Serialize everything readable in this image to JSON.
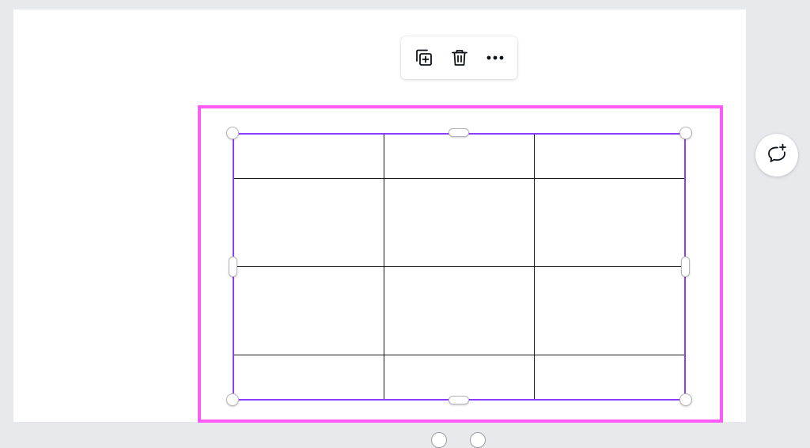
{
  "canvas": {
    "background": "#ffffff",
    "workspace_background": "#e8e9ed"
  },
  "toolbar": {
    "items": [
      {
        "icon": "duplicate-icon"
      },
      {
        "icon": "trash-icon"
      },
      {
        "icon": "more-horizontal-icon"
      }
    ]
  },
  "selection": {
    "frame_color": "#ff5bf7",
    "border_color": "#8b3dff"
  },
  "table": {
    "rows": 4,
    "columns": 3,
    "cells": [
      [
        "",
        "",
        ""
      ],
      [
        "",
        "",
        ""
      ],
      [
        "",
        "",
        ""
      ],
      [
        "",
        "",
        ""
      ]
    ],
    "line_color": "#1a1a1a"
  },
  "comment_button": {
    "icon": "add-comment-icon"
  }
}
